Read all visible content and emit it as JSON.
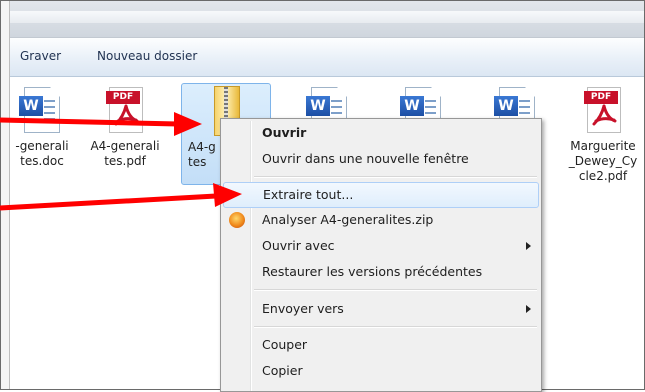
{
  "toolbar": {
    "burn_label": "Graver",
    "new_folder_label": "Nouveau dossier"
  },
  "files": [
    {
      "label": "-generali\ntes.doc",
      "icon": "word-document-icon"
    },
    {
      "label": "A4-generali\ntes.pdf",
      "icon": "pdf-document-icon"
    },
    {
      "label": "A4-g\ntes",
      "icon": "zip-folder-icon",
      "selected": true
    },
    {
      "label": "",
      "icon": "word-document-icon"
    },
    {
      "label": "",
      "icon": "word-document-icon"
    },
    {
      "label": "",
      "icon": "word-document-icon"
    },
    {
      "label": "Marguerite\n_Dewey_Cy\ncle2.pdf",
      "icon": "pdf-document-icon"
    }
  ],
  "icon_text": {
    "word": "W",
    "pdf": "PDF"
  },
  "context_menu": {
    "items": [
      {
        "label": "Ouvrir",
        "bold": true
      },
      {
        "label": "Ouvrir dans une nouvelle fenêtre"
      },
      {
        "label": "Extraire tout...",
        "highlighted": true
      },
      {
        "label": "Analyser A4-generalites.zip",
        "icon": "antivirus-scan-icon"
      },
      {
        "label": "Ouvrir avec",
        "submenu": true
      },
      {
        "label": "Restaurer les versions précédentes"
      },
      {
        "label": "Envoyer vers",
        "submenu": true
      },
      {
        "label": "Couper"
      },
      {
        "label": "Copier"
      }
    ]
  },
  "colors": {
    "annotation_arrow": "#ff0000",
    "menu_highlight": "#dfeefc",
    "pdf_red": "#c8112a",
    "word_blue": "#2a62be"
  }
}
